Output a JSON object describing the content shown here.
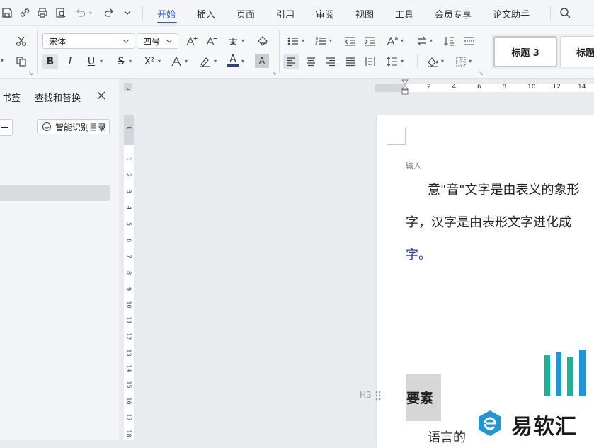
{
  "menu": {
    "tabs": [
      "开始",
      "插入",
      "页面",
      "引用",
      "审阅",
      "视图",
      "工具",
      "会员专享",
      "论文助手"
    ],
    "active_tab": "开始"
  },
  "ribbon": {
    "font_name": "宋体",
    "font_size": "四号",
    "style_cards": [
      "标题 3",
      "标题"
    ],
    "bold_label": "B",
    "italic_label": "I",
    "underline_label": "U",
    "strike_label": "S",
    "superscript_label": "X²",
    "font_color_label": "A",
    "char_shade_label": "A",
    "font_color": "#1f3fbf"
  },
  "nav_panel": {
    "tabs": [
      "书签",
      "查找和替换"
    ],
    "smart_toc_label": "智能识别目录"
  },
  "vruler_ticks": [
    "1",
    "1",
    "2",
    "3",
    "4",
    "5",
    "6",
    "7",
    "8",
    "9",
    "10",
    "11",
    "12",
    "13",
    "14",
    "15",
    "16",
    "17",
    "18"
  ],
  "hruler_ticks": [
    "2",
    "4",
    "6",
    "8",
    "10",
    "12",
    "14"
  ],
  "document": {
    "input_hint": "输入",
    "line1": "意\"音\"文字是由表义的象形",
    "line2": "字，汉字是由表形文字进化成",
    "line3": "字。",
    "heading_marker": "H3",
    "heading": "要素",
    "line4": "语言的"
  },
  "watermark": {
    "text": "易软汇"
  }
}
